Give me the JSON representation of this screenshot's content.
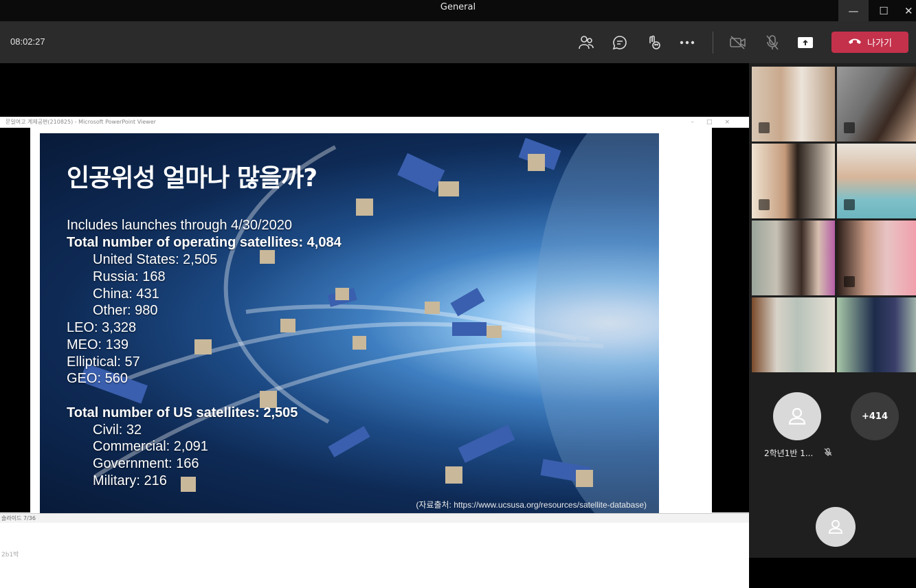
{
  "window": {
    "title": "General",
    "minimize_glyph": "—",
    "maximize_glyph": "☐",
    "close_glyph": "✕"
  },
  "toolbar": {
    "timer": "08:02:27",
    "icons": [
      "people-icon",
      "chat-icon",
      "reactions-icon",
      "more-icon",
      "camera-off-icon",
      "mic-off-icon",
      "share-screen-icon"
    ],
    "leave_label": "나가기"
  },
  "ppt": {
    "window_title": "문일여고 계제공편(210825) - Microsoft PowerPoint Viewer",
    "status_text": "슬라이드 7/36"
  },
  "slide": {
    "heading": "인공위성 얼마나 많을까?",
    "lines": [
      {
        "text": "Includes launches through 4/30/2020",
        "bold": false,
        "indent": false
      },
      {
        "text": "Total number of operating satellites: 4,084",
        "bold": true,
        "indent": false
      },
      {
        "text": "United States: 2,505",
        "bold": false,
        "indent": true
      },
      {
        "text": "Russia: 168",
        "bold": false,
        "indent": true
      },
      {
        "text": "China: 431",
        "bold": false,
        "indent": true
      },
      {
        "text": "Other: 980",
        "bold": false,
        "indent": true
      },
      {
        "text": "LEO: 3,328",
        "bold": false,
        "indent": false
      },
      {
        "text": "MEO: 139",
        "bold": false,
        "indent": false
      },
      {
        "text": "Elliptical: 57",
        "bold": false,
        "indent": false
      },
      {
        "text": "GEO: 560",
        "bold": false,
        "indent": false
      },
      {
        "text": "Total number of US satellites: 2,505",
        "bold": true,
        "indent": false
      },
      {
        "text": "Civil: 32",
        "bold": false,
        "indent": true
      },
      {
        "text": "Commercial: 2,091",
        "bold": false,
        "indent": true
      },
      {
        "text": "Government: 166",
        "bold": false,
        "indent": true
      },
      {
        "text": "Military: 216",
        "bold": false,
        "indent": true
      }
    ],
    "source": "(자료출처: https://www.ucsusa.org/resources/satellite-database)"
  },
  "gallery": {
    "participant_name": "2학년1반 1...",
    "overflow_count": "+414",
    "bottom_label": "2b1박"
  },
  "colors": {
    "leave": "#c4314b",
    "active_tile": "#7b83eb",
    "toolbar": "#2b2b2b"
  }
}
